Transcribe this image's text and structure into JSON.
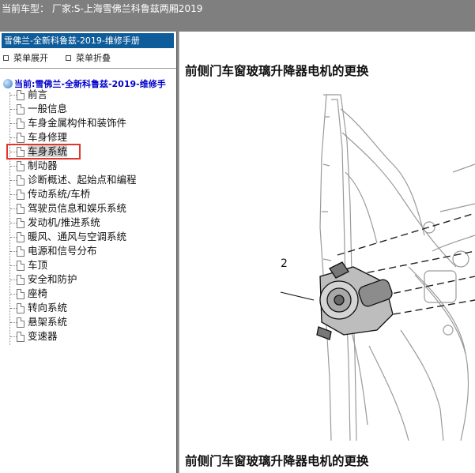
{
  "topbar": {
    "text": "当前车型：  厂家:S-上海雪佛兰科鲁兹两厢2019"
  },
  "sidebar": {
    "manual_title": "雪佛兰-全新科鲁兹-2019-维修手册",
    "expand_label": "菜单展开",
    "collapse_label": "菜单折叠",
    "current_label": "当前:雪佛兰-全新科鲁兹-2019-维修手",
    "items": [
      {
        "label": "前言"
      },
      {
        "label": "一般信息"
      },
      {
        "label": "车身金属构件和装饰件"
      },
      {
        "label": "车身修理"
      },
      {
        "label": "车身系统"
      },
      {
        "label": "制动器"
      },
      {
        "label": "诊断概述、起始点和编程"
      },
      {
        "label": "传动系统/车桥"
      },
      {
        "label": "驾驶员信息和娱乐系统"
      },
      {
        "label": "发动机/推进系统"
      },
      {
        "label": "暖风、通风与空调系统"
      },
      {
        "label": "电源和信号分布"
      },
      {
        "label": "车顶"
      },
      {
        "label": "安全和防护"
      },
      {
        "label": "座椅"
      },
      {
        "label": "转向系统"
      },
      {
        "label": "悬架系统"
      },
      {
        "label": "变速器"
      }
    ],
    "selected_index": 4
  },
  "main": {
    "heading": "前侧门车窗玻璃升降器电机的更换",
    "heading_bottom": "前侧门车窗玻璃升降器电机的更换",
    "callout": "2"
  }
}
